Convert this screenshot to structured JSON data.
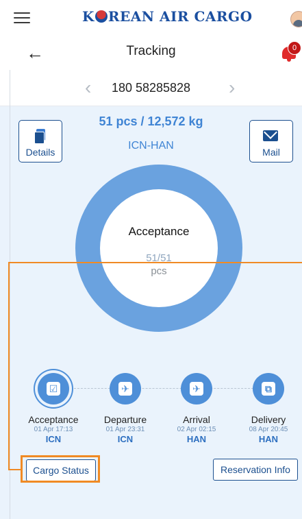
{
  "header": {
    "brand_prefix": "K",
    "brand_suffix": "REAN AIR CARGO",
    "menu_icon": "hamburger-menu-icon",
    "profile_icon": "profile-avatar-icon"
  },
  "titlebar": {
    "back_icon": "←",
    "title": "Tracking",
    "notification_count": "0"
  },
  "awb": {
    "prev_icon": "‹",
    "number": "180 58285828",
    "next_icon": "›"
  },
  "summary": {
    "pieces_weight": "51 pcs / 12,572 kg",
    "route": "ICN-HAN",
    "details_label": "Details",
    "mail_label": "Mail"
  },
  "donut": {
    "stage": "Acceptance",
    "count": "51/51",
    "unit": "pcs",
    "progress_fraction": 1.0
  },
  "timeline": [
    {
      "name": "Acceptance",
      "time": "01 Apr 17:13",
      "port": "ICN",
      "glyph": "☑",
      "icon": "checklist-icon"
    },
    {
      "name": "Departure",
      "time": "01 Apr 23:31",
      "port": "ICN",
      "glyph": "✈",
      "icon": "plane-departure-icon"
    },
    {
      "name": "Arrival",
      "time": "02 Apr 02:15",
      "port": "HAN",
      "glyph": "✈",
      "icon": "plane-arrival-icon"
    },
    {
      "name": "Delivery",
      "time": "08 Apr 20:45",
      "port": "HAN",
      "glyph": "⧉",
      "icon": "delivery-icon"
    }
  ],
  "actions": {
    "cargo_status": "Cargo Status",
    "reservation_info": "Reservation Info"
  },
  "colors": {
    "brand": "#1b4fa0",
    "accent": "#4e8fd8",
    "highlight": "#f08a24",
    "notification": "#e02b2b"
  }
}
